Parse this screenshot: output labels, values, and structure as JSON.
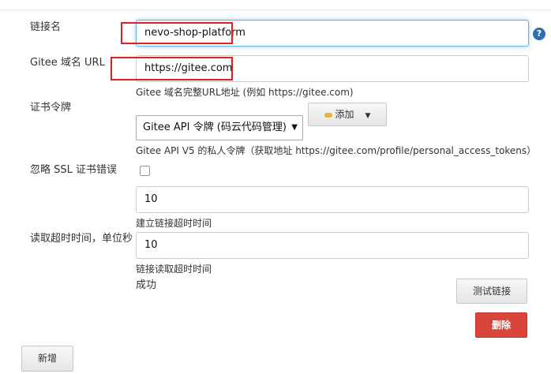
{
  "form": {
    "link_name": {
      "label": "链接名",
      "value": "nevo-shop-platform"
    },
    "gitee_url": {
      "label": "Gitee 域名 URL",
      "value": "https://gitee.com",
      "help": "Gitee 域名完整URL地址 (例如 https://gitee.com)"
    },
    "credentials": {
      "label": "证书令牌",
      "selected": "Gitee API 令牌 (码云代码管理)",
      "add_label": "添加",
      "help": "Gitee API V5 的私人令牌（获取地址 https://gitee.com/profile/personal_access_tokens）"
    },
    "ignore_ssl": {
      "label": "忽略 SSL 证书错误",
      "checked": false
    },
    "connect_timeout": {
      "value": "10",
      "help": "建立链接超时时间"
    },
    "read_timeout": {
      "label": "读取超时时间，单位秒",
      "value": "10",
      "help": "链接读取超时时间"
    },
    "status_text": "成功",
    "test_button": "测试链接",
    "delete_button": "删除",
    "add_new_button": "新增",
    "help_icon_glyph": "?"
  },
  "colors": {
    "highlight": "#e02020",
    "danger": "#d9453a",
    "help_icon": "#2f6fad"
  }
}
